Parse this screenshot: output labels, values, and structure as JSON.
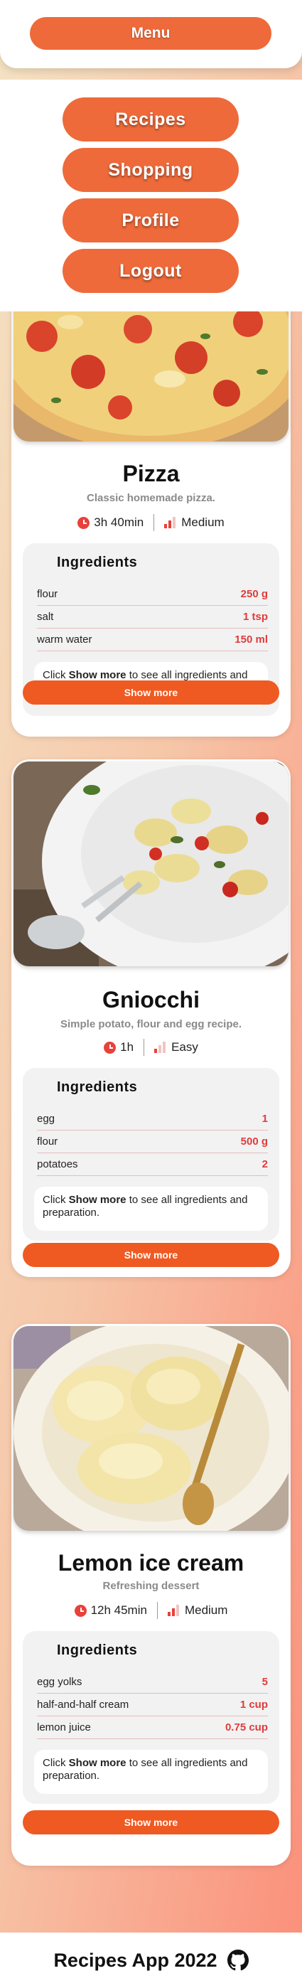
{
  "header": {
    "menu_label": "Menu"
  },
  "nav": {
    "items": [
      {
        "label": "Recipes"
      },
      {
        "label": "Shopping"
      },
      {
        "label": "Profile"
      },
      {
        "label": "Logout"
      }
    ]
  },
  "recipes": [
    {
      "title": "Pizza",
      "subtitle": "Classic homemade pizza.",
      "time": "3h 40min",
      "difficulty": "Medium",
      "ingredients_title": "Ingredients",
      "ingredients": [
        {
          "name": "flour",
          "qty": "250 g"
        },
        {
          "name": "salt",
          "qty": "1 tsp"
        },
        {
          "name": "warm water",
          "qty": "150 ml"
        }
      ],
      "note_prefix": "Click ",
      "note_bold": "Show more",
      "note_suffix": " to see all ingredients and preparation.",
      "show_more": "Show more",
      "icons": {
        "time": "clock-icon",
        "difficulty": "difficulty-icon"
      }
    },
    {
      "title": "Gniocchi",
      "subtitle": "Simple potato, flour and egg recipe.",
      "time": "1h",
      "difficulty": "Easy",
      "ingredients_title": "Ingredients",
      "ingredients": [
        {
          "name": "egg",
          "qty": "1"
        },
        {
          "name": "flour",
          "qty": "500 g"
        },
        {
          "name": "potatoes",
          "qty": "2"
        }
      ],
      "note_prefix": "Click ",
      "note_bold": "Show more",
      "note_suffix": " to see all ingredients and preparation.",
      "show_more": "Show more",
      "icons": {
        "time": "clock-icon",
        "difficulty": "difficulty-icon"
      }
    },
    {
      "title": "Lemon ice cream",
      "subtitle": "Refreshing dessert",
      "time": "12h 45min",
      "difficulty": "Medium",
      "ingredients_title": "Ingredients",
      "ingredients": [
        {
          "name": "egg yolks",
          "qty": "5"
        },
        {
          "name": "half-and-half cream",
          "qty": "1 cup"
        },
        {
          "name": "lemon juice",
          "qty": "0.75 cup"
        }
      ],
      "note_prefix": "Click ",
      "note_bold": "Show more",
      "note_suffix": " to see all ingredients and preparation.",
      "show_more": "Show more",
      "icons": {
        "time": "clock-icon",
        "difficulty": "difficulty-icon"
      }
    }
  ],
  "footer": {
    "text": "Recipes App 2022",
    "icon": "github-icon"
  },
  "colors": {
    "accent": "#ee6a3a",
    "quantity": "#e03b3b",
    "icon": "#e8413a"
  }
}
